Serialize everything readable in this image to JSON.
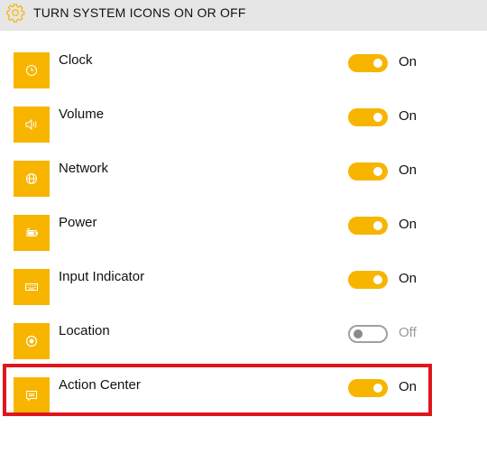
{
  "header": {
    "title": "TURN SYSTEM ICONS ON OR OFF",
    "icon": "gear-icon"
  },
  "items": [
    {
      "label": "Clock",
      "icon": "clock-icon",
      "on": true,
      "state": "On"
    },
    {
      "label": "Volume",
      "icon": "volume-icon",
      "on": true,
      "state": "On"
    },
    {
      "label": "Network",
      "icon": "network-icon",
      "on": true,
      "state": "On"
    },
    {
      "label": "Power",
      "icon": "battery-icon",
      "on": true,
      "state": "On"
    },
    {
      "label": "Input Indicator",
      "icon": "keyboard-icon",
      "on": true,
      "state": "On"
    },
    {
      "label": "Location",
      "icon": "location-icon",
      "on": false,
      "state": "Off"
    },
    {
      "label": "Action Center",
      "icon": "action-center-icon",
      "on": true,
      "state": "On"
    }
  ],
  "colors": {
    "accent": "#f7b500",
    "highlight": "#e0151d",
    "header_bg": "#e6e6e6"
  }
}
